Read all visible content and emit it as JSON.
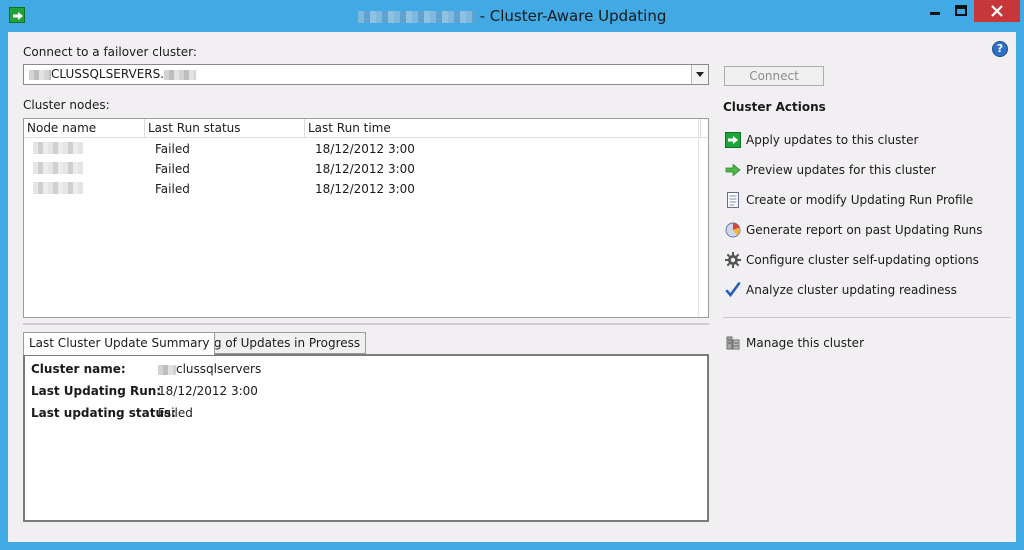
{
  "window": {
    "title": "- Cluster-Aware Updating"
  },
  "connect": {
    "label": "Connect to a failover cluster:",
    "cluster_value": "CLUSSQLSERVERS.",
    "connect_button": "Connect"
  },
  "nodes": {
    "label": "Cluster nodes:",
    "columns": [
      "Node name",
      "Last Run status",
      "Last Run time"
    ],
    "rows": [
      {
        "status": "Failed",
        "time": "18/12/2012 3:00"
      },
      {
        "status": "Failed",
        "time": "18/12/2012 3:00"
      },
      {
        "status": "Failed",
        "time": "18/12/2012 3:00"
      }
    ]
  },
  "tabs": [
    {
      "label": "Last Cluster Update Summary"
    },
    {
      "label": "Log of Updates in Progress"
    }
  ],
  "summary": {
    "cluster_name_label": "Cluster name:",
    "cluster_name_value": "clussqlservers",
    "last_run_label": "Last Updating Run:",
    "last_run_value": "18/12/2012 3:00",
    "last_status_label": "Last updating status:",
    "last_status_value": "Failed"
  },
  "actions": {
    "title": "Cluster Actions",
    "items": [
      {
        "label": "Apply updates to this cluster",
        "icon": "apply-updates-icon"
      },
      {
        "label": "Preview updates for this cluster",
        "icon": "preview-arrow-icon"
      },
      {
        "label": "Create or modify Updating Run Profile",
        "icon": "profile-notepad-icon"
      },
      {
        "label": "Generate report on past Updating Runs",
        "icon": "report-chart-icon"
      },
      {
        "label": "Configure cluster self-updating options",
        "icon": "gear-icon"
      },
      {
        "label": "Analyze cluster updating readiness",
        "icon": "checkmark-icon"
      }
    ],
    "manage_label": "Manage this cluster"
  },
  "colors": {
    "titlebar": "#41a9e4",
    "close_button": "#c7373a",
    "client_bg": "#f2eff2",
    "apply_icon": "#21a33b"
  }
}
